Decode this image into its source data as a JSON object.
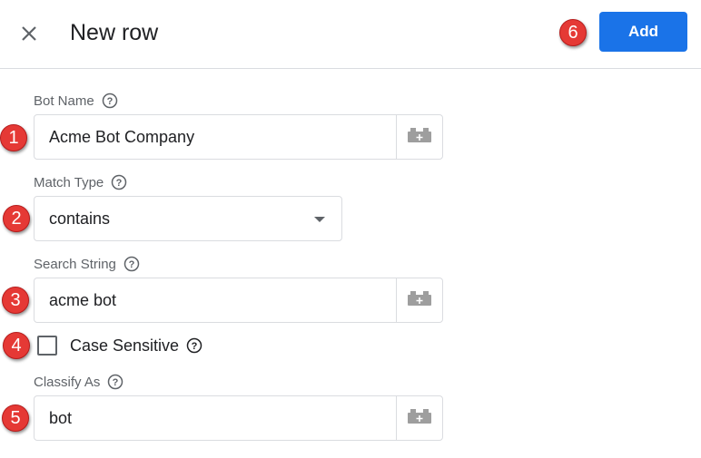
{
  "header": {
    "title": "New row",
    "add_label": "Add",
    "close_icon": "close-icon"
  },
  "fields": {
    "bot_name": {
      "label": "Bot Name",
      "value": "Acme Bot Company"
    },
    "match_type": {
      "label": "Match Type",
      "value": "contains"
    },
    "search_string": {
      "label": "Search String",
      "value": "acme bot"
    },
    "case_sensitive": {
      "label": "Case Sensitive",
      "checked": false
    },
    "classify_as": {
      "label": "Classify As",
      "value": "bot"
    }
  },
  "badges": [
    "1",
    "2",
    "3",
    "4",
    "5",
    "6"
  ],
  "colors": {
    "accent": "#1a73e8",
    "badge": "#e53935",
    "border": "#dadce0",
    "label": "#5f6368"
  }
}
